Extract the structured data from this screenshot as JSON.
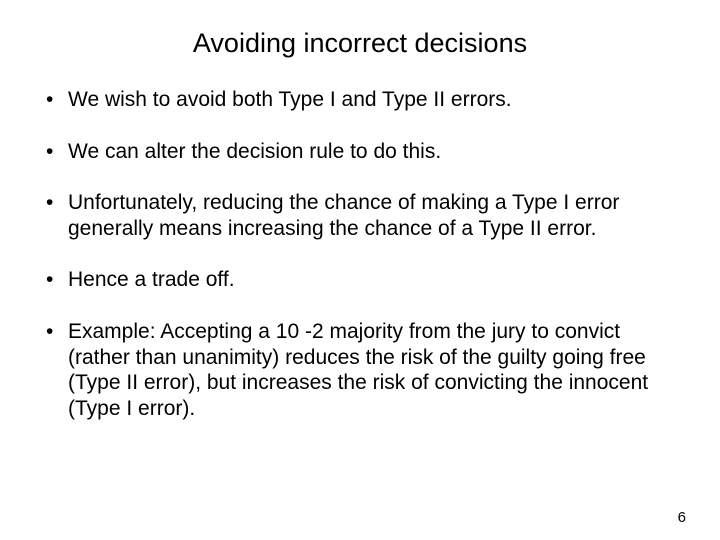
{
  "slide": {
    "title": "Avoiding incorrect decisions",
    "bullets": [
      "We wish to avoid both Type I and Type II errors.",
      "We can alter the decision rule to do this.",
      "Unfortunately, reducing the chance of making a Type I error generally means increasing the chance of a Type II error.",
      "Hence a trade off.",
      "Example: Accepting a 10 -2 majority from the jury to convict (rather than unanimity) reduces the risk of the guilty going free (Type II error), but increases the risk of convicting the innocent (Type I error)."
    ],
    "page_number": "6"
  }
}
